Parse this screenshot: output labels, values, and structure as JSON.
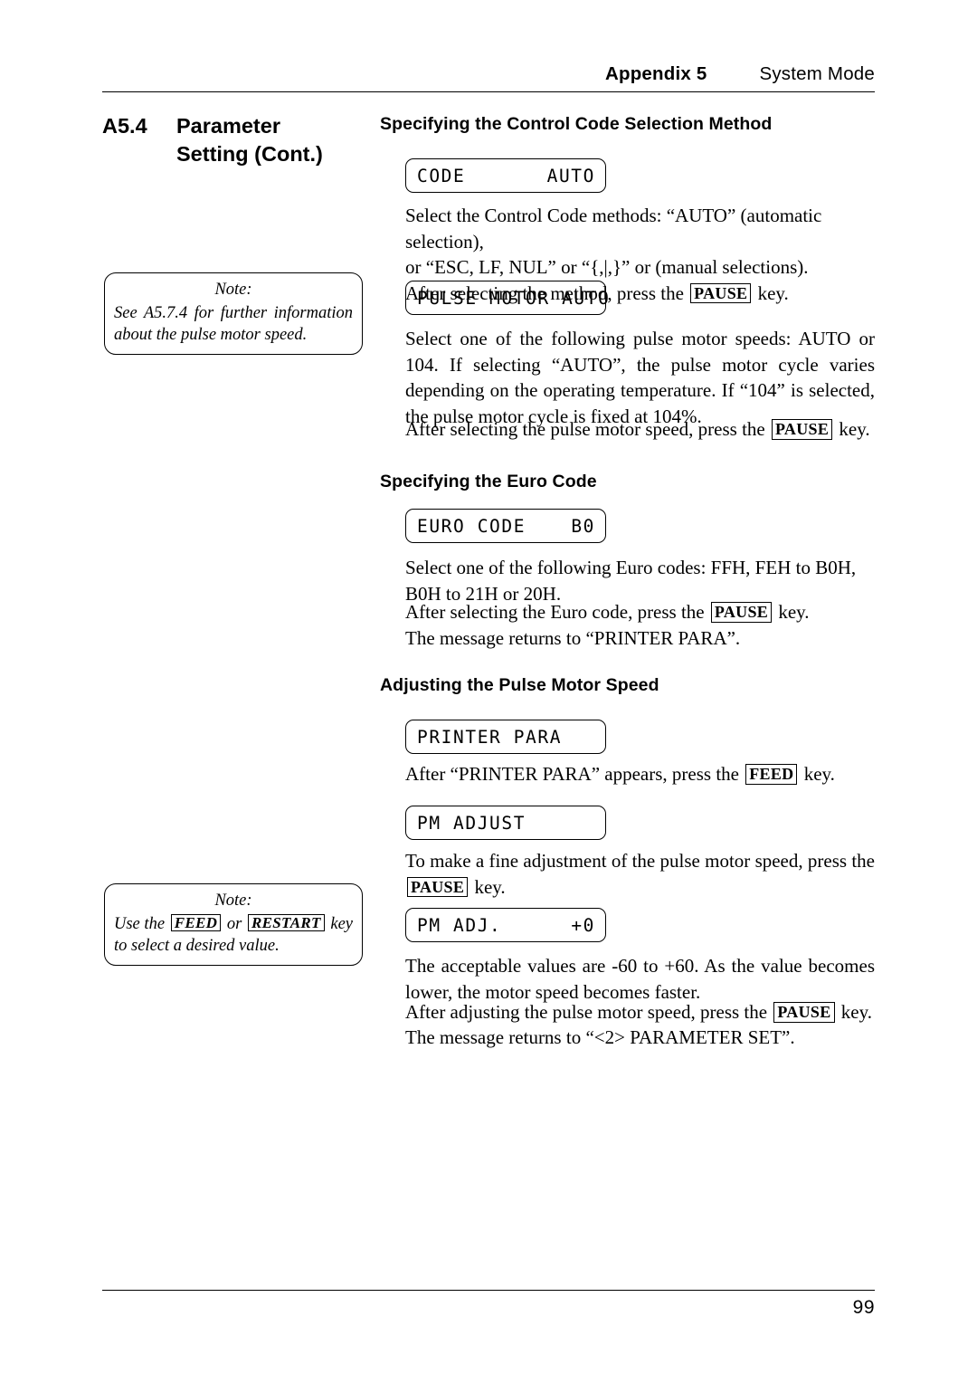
{
  "header": {
    "appendix": "Appendix 5",
    "title": "System Mode"
  },
  "footer": {
    "page_number": "99"
  },
  "section": {
    "number": "A5.4",
    "title_line1": "Parameter",
    "title_line2": "Setting (Cont.)"
  },
  "notes": [
    {
      "label": "Note:",
      "body": "See A5.7.4 for further information about the pulse motor speed."
    },
    {
      "label": "Note:",
      "body_part1": "Use the ",
      "key1": "FEED",
      "body_part2": " or ",
      "key2": "RESTART",
      "body_part3": " key to select a desired value."
    }
  ],
  "subheadings": {
    "control_code": "Specifying the Control Code Selection Method",
    "euro_code": "Specifying the Euro Code",
    "pulse_motor": "Adjusting the Pulse Motor Speed"
  },
  "lcd_displays": {
    "code": {
      "left": "CODE",
      "right": "AUTO"
    },
    "pulse_motor_auto": {
      "left": "PULSE MOTOR AUTO",
      "right": ""
    },
    "euro_code": {
      "left": "EURO CODE",
      "right": "B0"
    },
    "printer_para": {
      "left": "PRINTER PARA",
      "right": ""
    },
    "pm_adjust": {
      "left": "PM ADJUST",
      "right": ""
    },
    "pm_adj_value": {
      "left": "PM ADJ.",
      "right": "+0"
    }
  },
  "paragraphs": {
    "control_code": {
      "line1": "Select the Control Code methods: “AUTO” (automatic selection),",
      "line2": "or “ESC, LF, NUL” or “{,|,}” or (manual selections).",
      "line3_pre": "After selecting the method, press the ",
      "line3_key": "PAUSE",
      "line3_post": " key."
    },
    "pulse_motor": {
      "body": "Select one of the following pulse motor speeds: AUTO or 104. If selecting “AUTO”, the pulse motor cycle varies depending on the operating temperature.  If “104” is selected, the pulse motor cycle is fixed at 104%.",
      "line_pre": "After selecting the pulse motor speed, press the ",
      "line_key": "PAUSE",
      "line_post": " key."
    },
    "euro_code": {
      "body": "Select one of the following Euro codes: FFH, FEH to B0H, B0H to 21H or 20H.",
      "line_pre": "After selecting the Euro code, press the ",
      "line_key": "PAUSE",
      "line_post": " key.",
      "line_last": "The message returns to “PRINTER PARA”."
    },
    "printer_para": {
      "pre": "After “PRINTER PARA” appears, press the ",
      "key": "FEED",
      "post": " key."
    },
    "pm_adjust": {
      "pre": "To make a fine adjustment of the pulse motor speed, press the ",
      "key": "PAUSE",
      "post": " key."
    },
    "pm_values": {
      "body": "The acceptable values are -60 to +60.  As the value becomes lower, the motor speed becomes faster.",
      "line_pre": "After adjusting the pulse motor speed, press the ",
      "line_key": "PAUSE",
      "line_post": " key.",
      "line_last": "The message returns to “<2> PARAMETER SET”."
    }
  }
}
